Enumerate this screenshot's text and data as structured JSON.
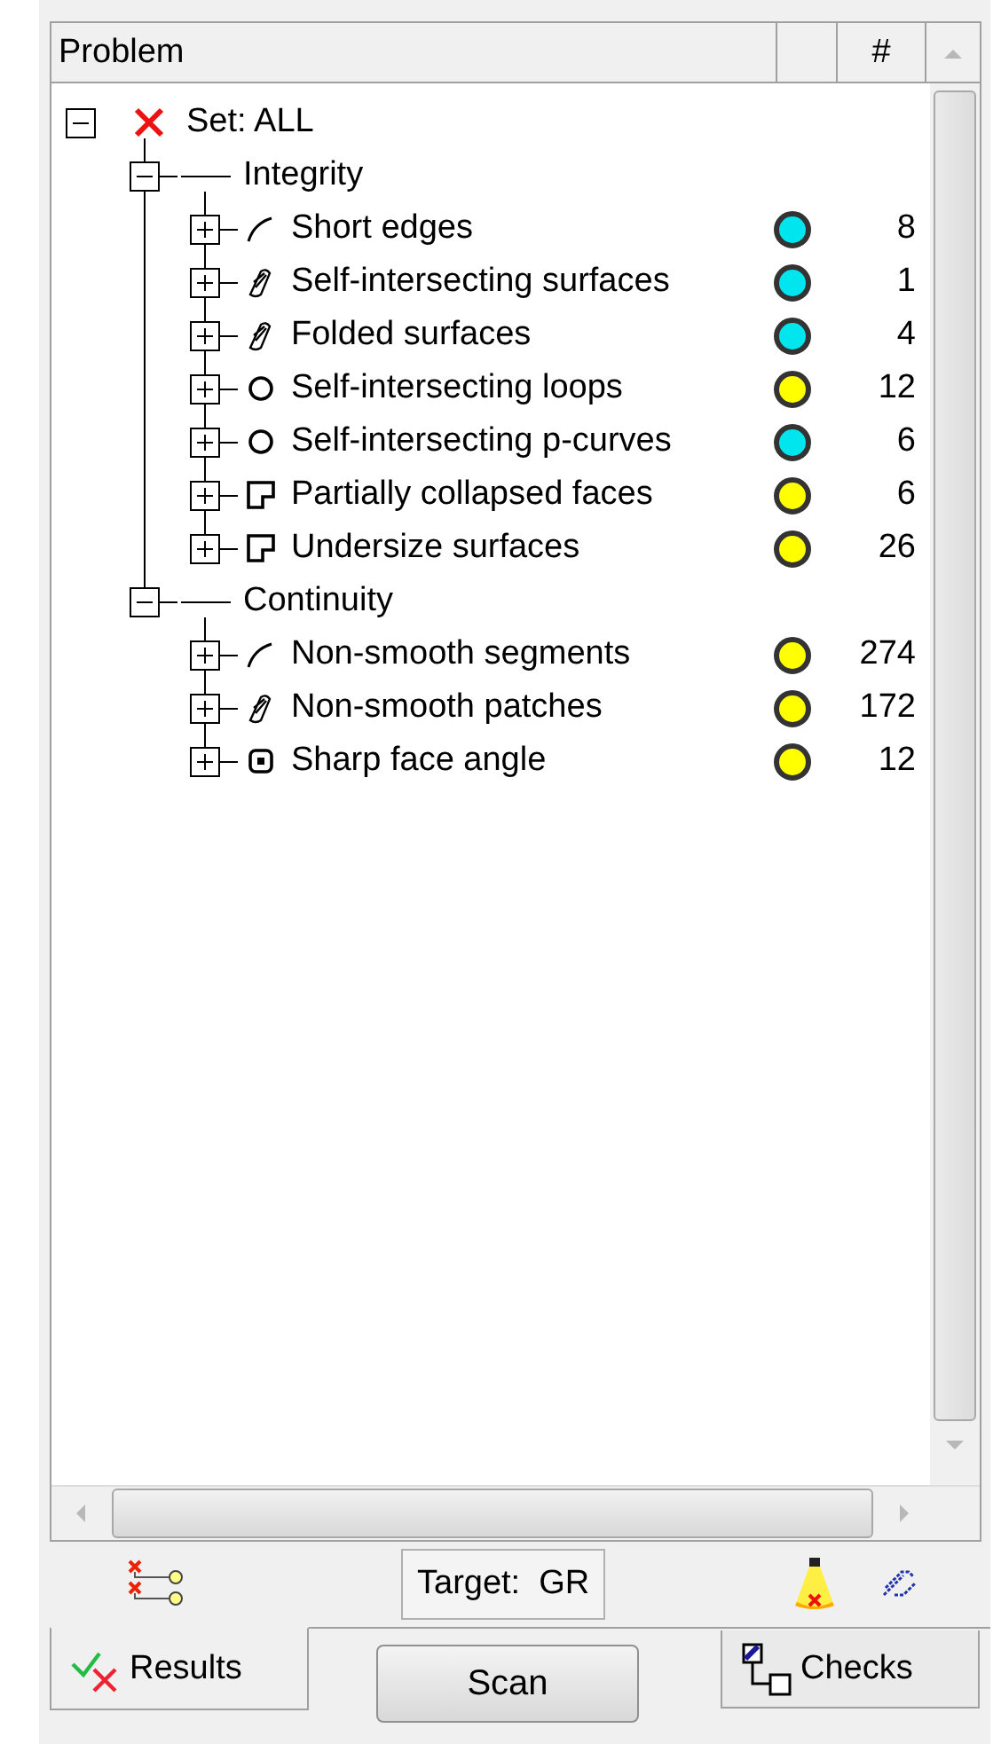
{
  "table": {
    "columns": [
      "Problem",
      "#"
    ]
  },
  "tree": {
    "label": "Set: ALL",
    "expanded": true,
    "children": [
      {
        "label": "Integrity",
        "expanded": true,
        "children": [
          {
            "label": "Short edges",
            "kind": "edge",
            "color": "#00e5ee",
            "count": "8",
            "expanded": false
          },
          {
            "label": "Self-intersecting surfaces",
            "kind": "surface",
            "color": "#00e5ee",
            "count": "1",
            "expanded": false
          },
          {
            "label": "Folded surfaces",
            "kind": "surface",
            "color": "#00e5ee",
            "count": "4",
            "expanded": false
          },
          {
            "label": "Self-intersecting loops",
            "kind": "loop",
            "color": "#ffff00",
            "count": "12",
            "expanded": false
          },
          {
            "label": "Self-intersecting p-curves",
            "kind": "loop",
            "color": "#00e5ee",
            "count": "6",
            "expanded": false
          },
          {
            "label": "Partially collapsed faces",
            "kind": "face",
            "color": "#ffff00",
            "count": "6",
            "expanded": false
          },
          {
            "label": "Undersize surfaces",
            "kind": "face",
            "color": "#ffff00",
            "count": "26",
            "expanded": false
          }
        ]
      },
      {
        "label": "Continuity",
        "expanded": true,
        "children": [
          {
            "label": "Non-smooth segments",
            "kind": "edge",
            "color": "#ffff00",
            "count": "274",
            "expanded": false
          },
          {
            "label": "Non-smooth patches",
            "kind": "surface",
            "color": "#ffff00",
            "count": "172",
            "expanded": false
          },
          {
            "label": "Sharp face angle",
            "kind": "angle",
            "color": "#ffff00",
            "count": "12",
            "expanded": false
          }
        ]
      }
    ]
  },
  "toolbar": {
    "target": "Target:  GR"
  },
  "tabs": [
    {
      "label": "Results",
      "selected": true
    },
    {
      "label": "Scan",
      "kind": "button"
    },
    {
      "label": "Checks",
      "selected": false
    }
  ]
}
